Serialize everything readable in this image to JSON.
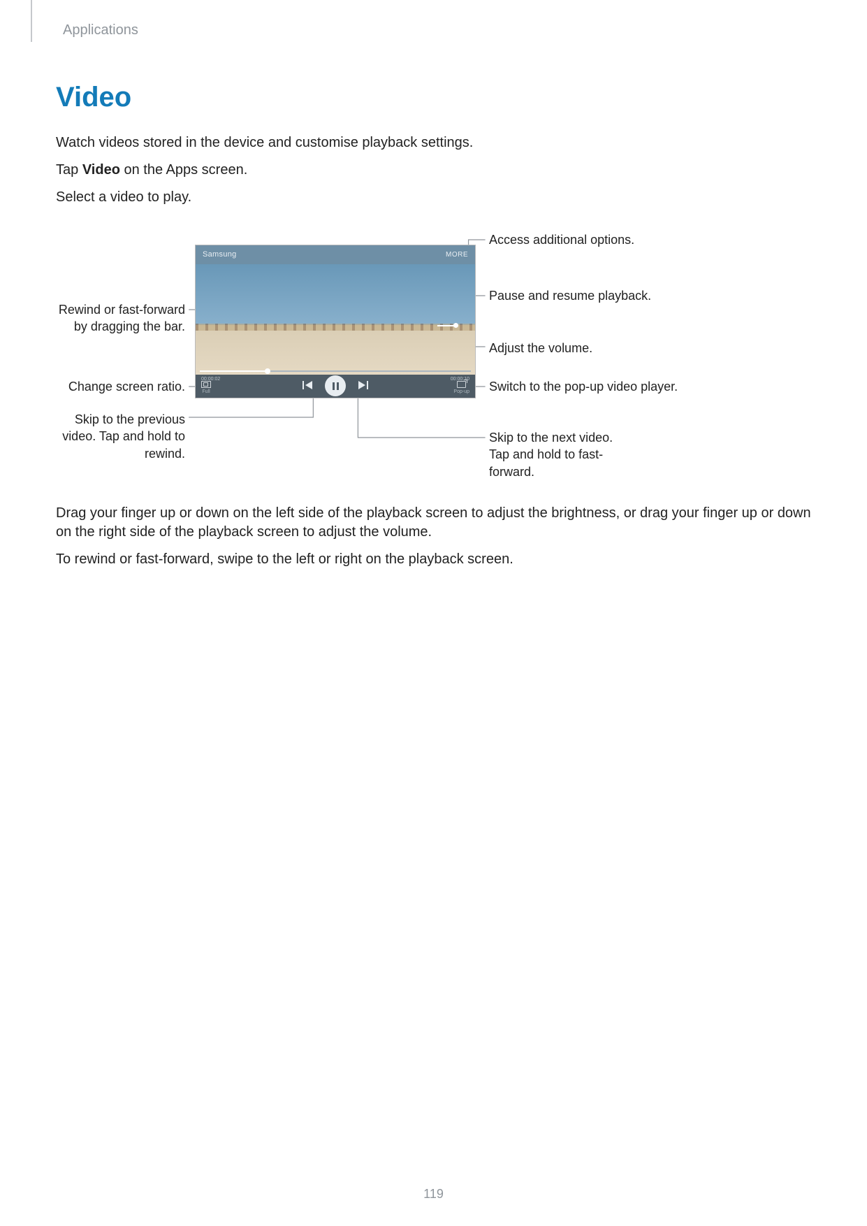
{
  "header": {
    "section": "Applications"
  },
  "title": "Video",
  "intro": [
    "Watch videos stored in the device and customise playback settings.",
    "Select a video to play."
  ],
  "tap_line": {
    "prefix": "Tap ",
    "bold": "Video",
    "suffix": " on the Apps screen."
  },
  "player": {
    "title": "Samsung",
    "more_label": "MORE",
    "elapsed": "00:00:02",
    "duration": "00:00:10",
    "ratio_label": "Full",
    "popup_label": "Pop-up"
  },
  "callouts": {
    "right": [
      "Access additional options.",
      "Pause and resume playback.",
      "Adjust the volume.",
      "Switch to the pop-up video player.",
      "Skip to the next video. Tap and hold to fast-forward."
    ],
    "left": [
      "Rewind or fast-forward by dragging the bar.",
      "Change screen ratio.",
      "Skip to the previous video. Tap and hold to rewind."
    ]
  },
  "after": [
    "Drag your finger up or down on the left side of the playback screen to adjust the brightness, or drag your finger up or down on the right side of the playback screen to adjust the volume.",
    "To rewind or fast-forward, swipe to the left or right on the playback screen."
  ],
  "page_number": "119"
}
